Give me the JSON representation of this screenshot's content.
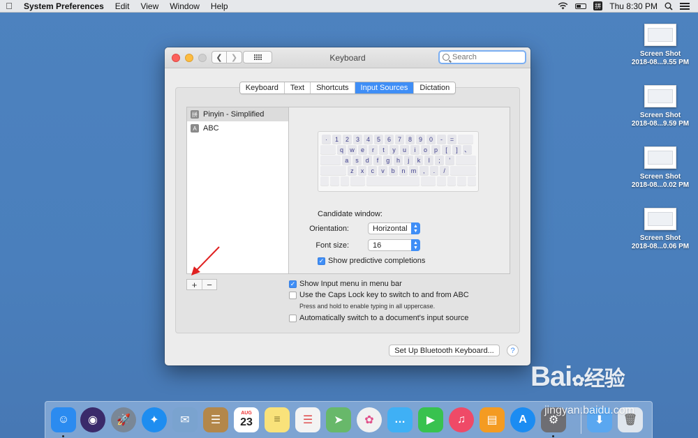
{
  "menubar": {
    "app_name": "System Preferences",
    "menus": [
      "Edit",
      "View",
      "Window",
      "Help"
    ],
    "ime_char": "拼",
    "clock": "Thu 8:30 PM",
    "icons": [
      "apple-icon",
      "wifi-icon",
      "battery-icon",
      "input-source-icon",
      "spotlight-icon",
      "notification-center-icon"
    ]
  },
  "desktop": {
    "files": [
      {
        "line1": "Screen Shot",
        "line2": "2018-08...9.55 PM"
      },
      {
        "line1": "Screen Shot",
        "line2": "2018-08...9.59 PM"
      },
      {
        "line1": "Screen Shot",
        "line2": "2018-08...0.02 PM"
      },
      {
        "line1": "Screen Shot",
        "line2": "2018-08...0.06 PM"
      }
    ]
  },
  "window": {
    "title": "Keyboard",
    "search_placeholder": "Search",
    "tabs": [
      {
        "label": "Keyboard",
        "active": false
      },
      {
        "label": "Text",
        "active": false
      },
      {
        "label": "Shortcuts",
        "active": false
      },
      {
        "label": "Input Sources",
        "active": true
      },
      {
        "label": "Dictation",
        "active": false
      }
    ],
    "sources": [
      {
        "badge": "拼",
        "label": "Pinyin - Simplified",
        "selected": true
      },
      {
        "badge": "A",
        "label": "ABC",
        "selected": false
      }
    ],
    "keyboard_rows": [
      [
        "·",
        "1",
        "2",
        "3",
        "4",
        "5",
        "6",
        "7",
        "8",
        "9",
        "0",
        "-",
        "="
      ],
      [
        "q",
        "w",
        "e",
        "r",
        "t",
        "y",
        "u",
        "i",
        "o",
        "p",
        "[",
        "]",
        "、"
      ],
      [
        "a",
        "s",
        "d",
        "f",
        "g",
        "h",
        "j",
        "k",
        "l",
        ";",
        "'"
      ],
      [
        "z",
        "x",
        "c",
        "v",
        "b",
        "n",
        "m",
        ",",
        ".",
        "/"
      ]
    ],
    "candidate_title": "Candidate window:",
    "orientation_label": "Orientation:",
    "orientation_value": "Horizontal",
    "fontsize_label": "Font size:",
    "fontsize_value": "16",
    "predictive_label": "Show predictive completions",
    "predictive_checked": true,
    "show_menu_label": "Show Input menu in menu bar",
    "show_menu_checked": true,
    "capslock_label": "Use the Caps Lock key to switch to and from ABC",
    "capslock_checked": false,
    "capslock_hint": "Press and hold to enable typing in all uppercase.",
    "autoswitch_label": "Automatically switch to a document's input source",
    "autoswitch_checked": false,
    "add_label": "+",
    "remove_label": "−",
    "bluetooth_button": "Set Up Bluetooth Keyboard...",
    "help_label": "?"
  },
  "dock": {
    "apps": [
      {
        "name": "finder-icon",
        "color": "#2b8bf0",
        "glyph": "☺"
      },
      {
        "name": "siri-icon",
        "color": "#3a2a6a",
        "glyph": "◉"
      },
      {
        "name": "launchpad-icon",
        "color": "#7a8796",
        "glyph": "🚀"
      },
      {
        "name": "safari-icon",
        "color": "#1e8df0",
        "glyph": "✦"
      },
      {
        "name": "mail-icon",
        "color": "#7aa3cf",
        "glyph": "✉"
      },
      {
        "name": "contacts-icon",
        "color": "#b3874a",
        "glyph": "☰"
      },
      {
        "name": "calendar-icon",
        "color": "#ffffff",
        "glyph": "23"
      },
      {
        "name": "notes-icon",
        "color": "#f9e27a",
        "glyph": "≡"
      },
      {
        "name": "reminders-icon",
        "color": "#f3f3f3",
        "glyph": "☰"
      },
      {
        "name": "maps-icon",
        "color": "#68b86a",
        "glyph": "➤"
      },
      {
        "name": "photos-icon",
        "color": "#f1f1f1",
        "glyph": "✿"
      },
      {
        "name": "messages-icon",
        "color": "#3fb0f5",
        "glyph": "…"
      },
      {
        "name": "facetime-icon",
        "color": "#38c24f",
        "glyph": "▶"
      },
      {
        "name": "music-icon",
        "color": "#ef4a67",
        "glyph": "♫"
      },
      {
        "name": "books-icon",
        "color": "#f49b22",
        "glyph": "▤"
      },
      {
        "name": "app-store-icon",
        "color": "#1b8cf2",
        "glyph": "A"
      },
      {
        "name": "system-preferences-icon",
        "color": "#6e6e73",
        "glyph": "⚙"
      },
      {
        "name": "downloads-icon",
        "color": "#5aa7f0",
        "glyph": "⬇"
      },
      {
        "name": "trash-icon",
        "color": "#dfe6ee",
        "glyph": "🗑"
      }
    ],
    "calendar_month": "AUG"
  },
  "watermark": {
    "big": "Bai",
    "big2": "经验",
    "url": "jingyan.baidu.com"
  }
}
